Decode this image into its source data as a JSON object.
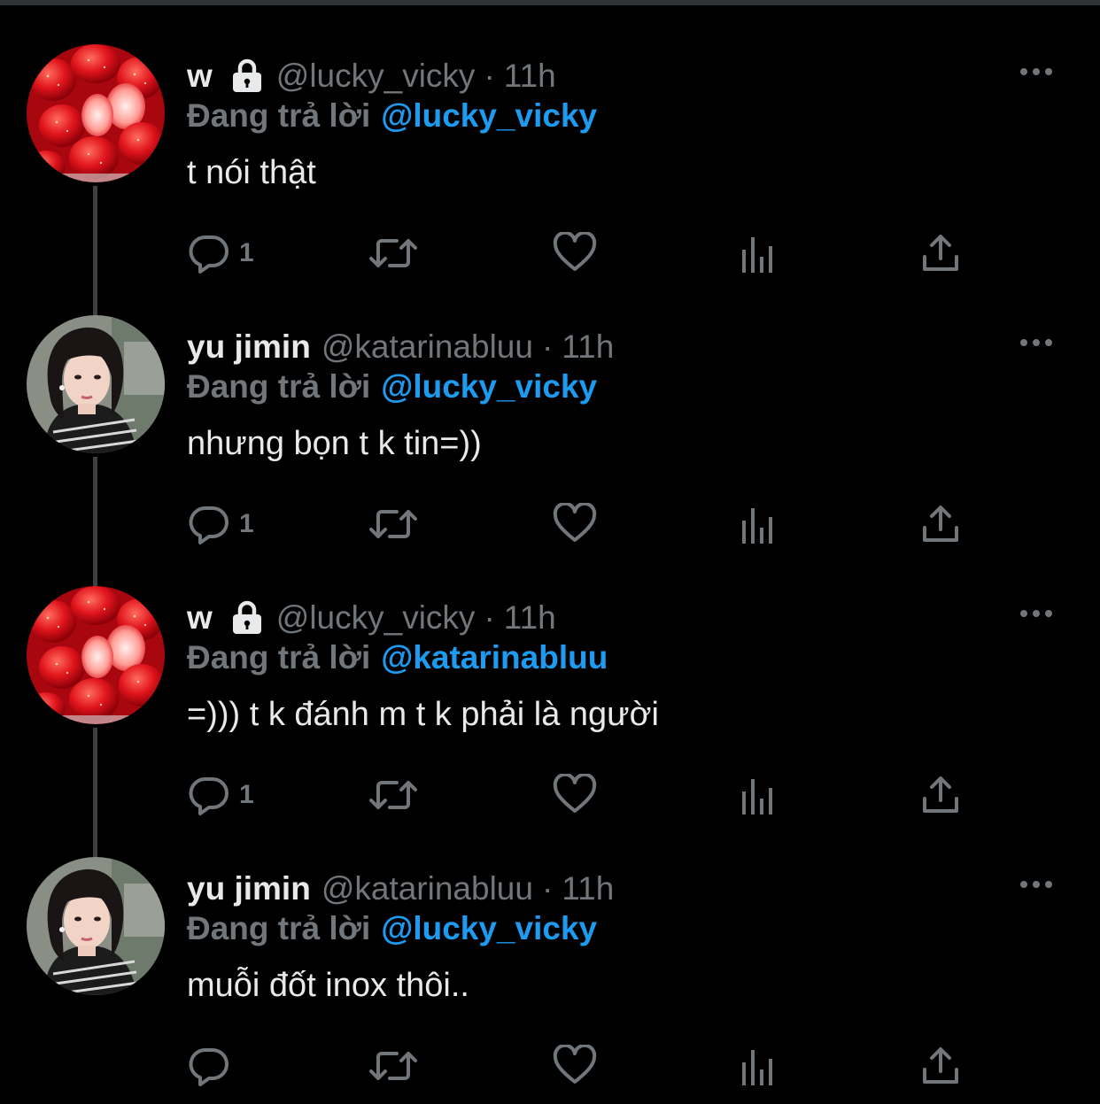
{
  "theme": {
    "background": "#000000",
    "text": "#e7e9ea",
    "muted": "#71767b",
    "accent": "#1d9bf0",
    "thread_line": "#3e4144"
  },
  "tweets": [
    {
      "avatar": "strawberries-avatar",
      "display_name": "w",
      "locked": true,
      "handle": "@lucky_vicky",
      "dot": "·",
      "time": "11h",
      "reply_prefix": "Đang trả lời",
      "reply_to": "@lucky_vicky",
      "text": "t nói thật",
      "reply_count": "1"
    },
    {
      "avatar": "yu-jimin-avatar",
      "display_name": "yu jimin",
      "locked": false,
      "handle": "@katarinabluu",
      "dot": "·",
      "time": "11h",
      "reply_prefix": "Đang trả lời",
      "reply_to": "@lucky_vicky",
      "text": "nhưng bọn t k tin=))",
      "reply_count": "1"
    },
    {
      "avatar": "strawberries-avatar",
      "display_name": "w",
      "locked": true,
      "handle": "@lucky_vicky",
      "dot": "·",
      "time": "11h",
      "reply_prefix": "Đang trả lời",
      "reply_to": "@katarinabluu",
      "text": "=))) t k đánh m t k phải là người",
      "reply_count": "1"
    },
    {
      "avatar": "yu-jimin-avatar",
      "display_name": "yu jimin",
      "locked": false,
      "handle": "@katarinabluu",
      "dot": "·",
      "time": "11h",
      "reply_prefix": "Đang trả lời",
      "reply_to": "@lucky_vicky",
      "text": "muỗi đốt inox thôi..",
      "reply_count": ""
    }
  ]
}
